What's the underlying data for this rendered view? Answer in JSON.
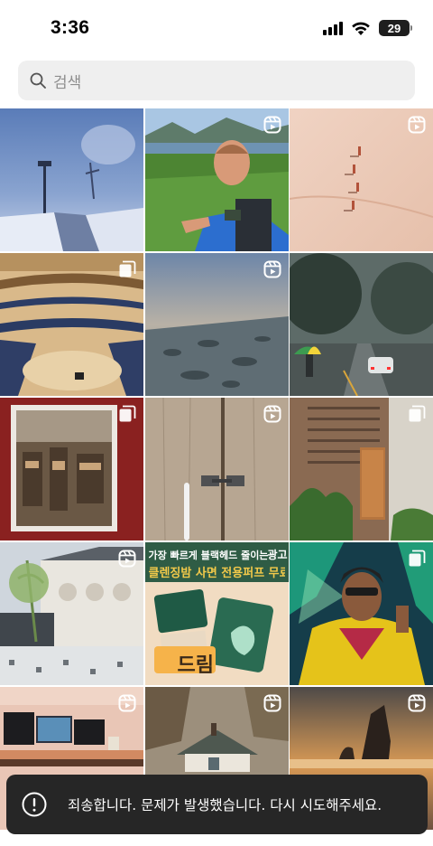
{
  "status_bar": {
    "time": "3:36",
    "battery": "29",
    "icons": [
      "signal-icon",
      "wifi-icon",
      "battery-icon"
    ]
  },
  "search": {
    "placeholder": "검색",
    "icon": "search-icon"
  },
  "grid": {
    "tiles": [
      {
        "subject": "foggy-winter-path",
        "badge": null
      },
      {
        "subject": "man-hiking-selfie-mountain-lake",
        "badge": "reels-icon"
      },
      {
        "subject": "desert-footprints",
        "badge": "reels-icon"
      },
      {
        "subject": "concert-hall-interior",
        "badge": "carousel-icon"
      },
      {
        "subject": "coastline-sunset-rocks",
        "badge": "reels-icon"
      },
      {
        "subject": "rainy-street-umbrella-car",
        "badge": null
      },
      {
        "subject": "framed-workshop-painting",
        "badge": "carousel-icon"
      },
      {
        "subject": "wooden-door-latch",
        "badge": "reels-icon"
      },
      {
        "subject": "brick-house-wooden-door",
        "badge": "carousel-icon"
      },
      {
        "subject": "ornate-building-plaza-tree",
        "badge": "reels-icon"
      },
      {
        "subject": "product-ad-korean",
        "badge": null,
        "ad_label": "광고",
        "line1": "가장 빠르게 블랙헤드 줄이는 조",
        "line2": "클렌징밤 사면 전용퍼프 무료",
        "sticker": "드림"
      },
      {
        "subject": "cyberpunk-woman-illustration",
        "badge": "carousel-icon"
      },
      {
        "subject": "desk-setup-monitors",
        "badge": "reels-icon"
      },
      {
        "subject": "cottage-forest",
        "badge": "reels-icon"
      },
      {
        "subject": "sunset-sea-rock",
        "badge": "reels-icon"
      }
    ]
  },
  "toast": {
    "message": "죄송합니다. 문제가 발생했습니다. 다시 시도해주세요.",
    "icon": "error-icon"
  }
}
